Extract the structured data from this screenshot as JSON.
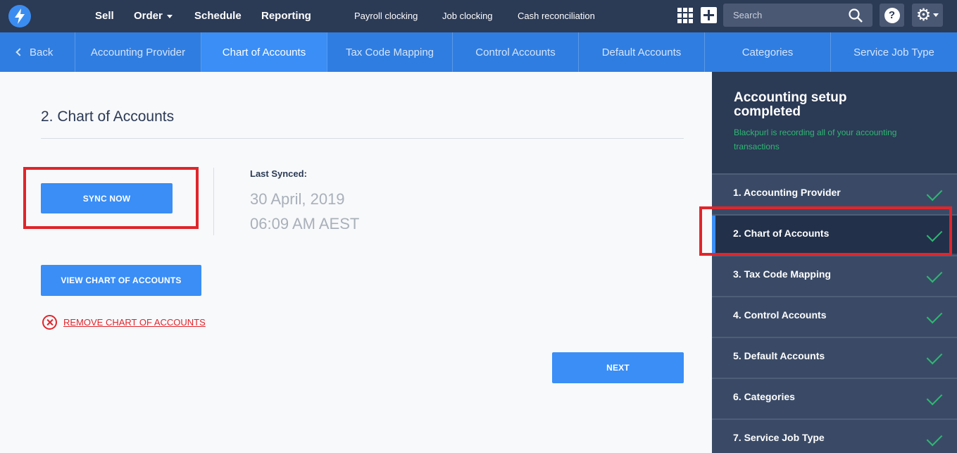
{
  "topnav": {
    "items": [
      {
        "label": "Sell",
        "has_dropdown": false
      },
      {
        "label": "Order",
        "has_dropdown": true
      },
      {
        "label": "Schedule",
        "has_dropdown": false
      },
      {
        "label": "Reporting",
        "has_dropdown": false
      }
    ],
    "sub_items": [
      "Payroll clocking",
      "Job clocking",
      "Cash reconciliation"
    ],
    "search": {
      "placeholder": "Search"
    },
    "help_label": "?"
  },
  "tabs": {
    "back_label": "Back",
    "items": [
      {
        "label": "Accounting Provider",
        "active": false
      },
      {
        "label": "Chart of Accounts",
        "active": true
      },
      {
        "label": "Tax Code Mapping",
        "active": false
      },
      {
        "label": "Control Accounts",
        "active": false
      },
      {
        "label": "Default Accounts",
        "active": false
      },
      {
        "label": "Categories",
        "active": false
      },
      {
        "label": "Service Job Type",
        "active": false
      }
    ]
  },
  "main": {
    "title": "2. Chart of Accounts",
    "sync_button": "SYNC NOW",
    "last_synced_label": "Last Synced:",
    "last_synced_date": "30 April, 2019",
    "last_synced_time": "06:09 AM AEST",
    "view_button": "VIEW CHART OF ACCOUNTS",
    "remove_link": "REMOVE CHART OF ACCOUNTS",
    "next_button": "NEXT"
  },
  "sidebar": {
    "title": "Accounting setup completed",
    "subtitle": "Blackpurl is recording all of your accounting transactions",
    "steps": [
      {
        "label": "1. Accounting Provider",
        "completed": true,
        "active": false
      },
      {
        "label": "2. Chart of Accounts",
        "completed": true,
        "active": true
      },
      {
        "label": "3. Tax Code Mapping",
        "completed": true,
        "active": false
      },
      {
        "label": "4. Control Accounts",
        "completed": true,
        "active": false
      },
      {
        "label": "5. Default Accounts",
        "completed": true,
        "active": false
      },
      {
        "label": "6. Categories",
        "completed": true,
        "active": false
      },
      {
        "label": "7. Service Job Type",
        "completed": true,
        "active": false
      }
    ]
  },
  "colors": {
    "topbar": "#2b3a55",
    "tabbar": "#2f7de1",
    "accent": "#3a8ef6",
    "success": "#2eb872",
    "danger": "#e0252b",
    "highlight": "#e0252b"
  }
}
